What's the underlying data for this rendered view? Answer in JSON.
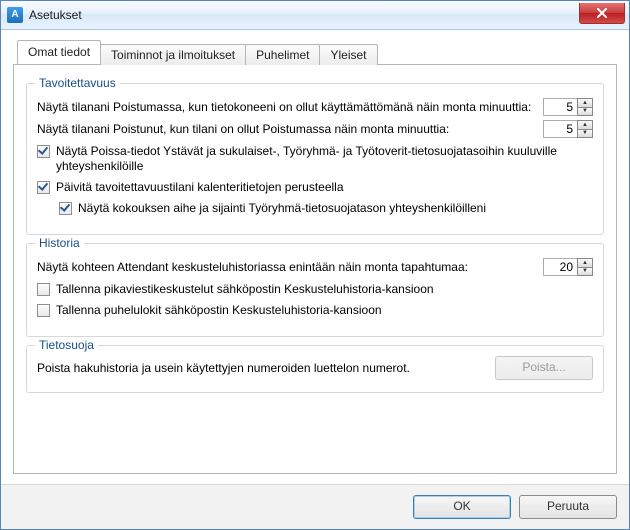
{
  "window": {
    "title": "Asetukset",
    "app_icon_letter": "A"
  },
  "tabs": [
    {
      "label": "Omat tiedot"
    },
    {
      "label": "Toiminnot ja ilmoitukset"
    },
    {
      "label": "Puhelimet"
    },
    {
      "label": "Yleiset"
    }
  ],
  "availability": {
    "legend": "Tavoitettavuus",
    "inactive_label": "Näytä tilanani Poistumassa, kun tietokoneeni on ollut käyttämättömänä näin monta minuuttia:",
    "inactive_value": "5",
    "away_label": "Näytä tilanani Poistunut, kun tilani on ollut Poistumassa näin monta minuuttia:",
    "away_value": "5",
    "share_away_label": "Näytä Poissa-tiedot Ystävät ja sukulaiset-, Työryhmä- ja Työtoverit-tietosuojatasoihin kuuluville yhteyshenkilöille",
    "calendar_update_label": "Päivitä tavoitettavuustilani kalenteritietojen perusteella",
    "meeting_detail_label": "Näytä kokouksen aihe ja sijainti Työryhmä-tietosuojatason yhteyshenkilöilleni"
  },
  "history": {
    "legend": "Historia",
    "max_events_label": "Näytä kohteen Attendant keskusteluhistoriassa enintään näin monta tapahtumaa:",
    "max_events_value": "20",
    "save_im_label": "Tallenna pikaviestikeskustelut sähköpostin Keskusteluhistoria-kansioon",
    "save_calls_label": "Tallenna puhelulokit sähköpostin Keskusteluhistoria-kansioon"
  },
  "privacy": {
    "legend": "Tietosuoja",
    "desc": "Poista hakuhistoria ja usein käytettyjen numeroiden luettelon numerot.",
    "clear_label": "Poista..."
  },
  "footer": {
    "ok": "OK",
    "cancel": "Peruuta"
  }
}
